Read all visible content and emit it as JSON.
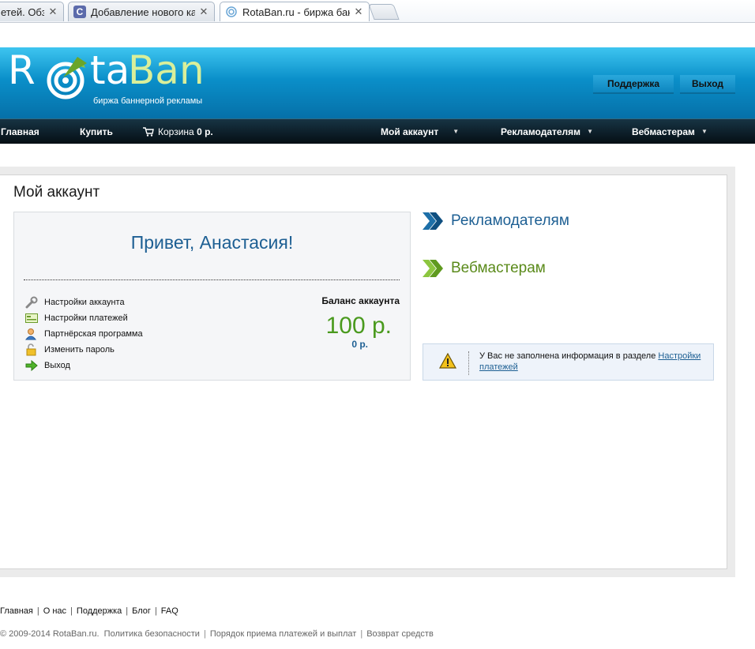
{
  "browser": {
    "tabs": [
      {
        "title": "етей. Обзо",
        "active": false
      },
      {
        "title": "Добавление нового кана",
        "active": false
      },
      {
        "title": "RotaBan.ru - биржа банне",
        "active": true
      }
    ],
    "close_glyph": "✕"
  },
  "header": {
    "logo_r": "R",
    "logo_ta": "ta",
    "logo_ban": "Ban",
    "logo_tagline": "биржа баннерной рекламы",
    "support_label": "Поддержка",
    "logout_label": "Выход",
    "brand_color": "#0a8fc9"
  },
  "nav": {
    "home": "Главная",
    "buy": "Купить",
    "cart_label": "Корзина",
    "cart_amount": "0 р.",
    "my_account": "Мой аккаунт",
    "advertisers": "Рекламодателям",
    "webmasters": "Вебмастерам"
  },
  "main": {
    "page_title": "Мой аккаунт",
    "greeting": "Привет, Анастасия!",
    "menu": [
      {
        "label": "Настройки аккаунта",
        "icon": "wrench-icon"
      },
      {
        "label": "Настройки платежей",
        "icon": "payment-card-icon"
      },
      {
        "label": "Партнёрская программа",
        "icon": "users-icon"
      },
      {
        "label": "Изменить пароль",
        "icon": "lock-icon"
      },
      {
        "label": "Выход",
        "icon": "arrow-right-icon"
      }
    ],
    "balance_label": "Баланс аккаунта",
    "balance_value": "100 р.",
    "balance_sub": "0 р.",
    "side_links": {
      "advertisers": "Рекламодателям",
      "webmasters": "Вебмастерам"
    },
    "alert": {
      "text": "У Вас не заполнена информация в разделе ",
      "link": "Настройки платежей"
    }
  },
  "footer": {
    "links": [
      "Главная",
      "О нас",
      "Поддержка",
      "Блог",
      "FAQ"
    ],
    "copyright": "© 2009-2014 RotaBan.ru.",
    "policy_links": [
      "Политика безопасности",
      "Порядок приема платежей и выплат",
      "Возврат средств"
    ]
  }
}
